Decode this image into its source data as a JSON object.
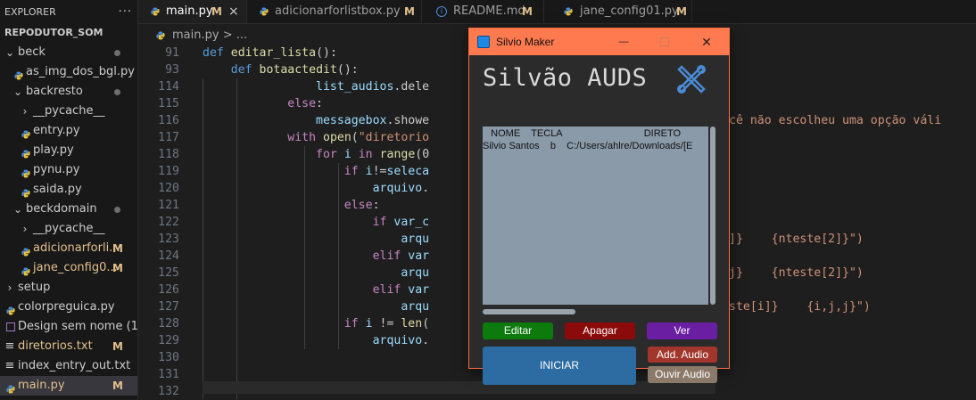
{
  "sidebar": {
    "header": "EXPLORER",
    "more": "···",
    "project": "REPODUTOR_SOM",
    "items": [
      {
        "label": "beck",
        "type": "folder-open"
      },
      {
        "label": "as_img_dos_bgl.py",
        "type": "py"
      },
      {
        "label": "backresto",
        "type": "folder-open"
      },
      {
        "label": "__pycache__",
        "type": "folder-closed"
      },
      {
        "label": "entry.py",
        "type": "py"
      },
      {
        "label": "play.py",
        "type": "py"
      },
      {
        "label": "pynu.py",
        "type": "py"
      },
      {
        "label": "saida.py",
        "type": "py"
      },
      {
        "label": "beckdomain",
        "type": "folder-open"
      },
      {
        "label": "__pycache__",
        "type": "folder-closed"
      },
      {
        "label": "adicionarforli...",
        "type": "py",
        "mark": "M"
      },
      {
        "label": "jane_config0...",
        "type": "py",
        "mark": "M"
      },
      {
        "label": "setup",
        "type": "folder-closed"
      },
      {
        "label": "colorpreguica.py",
        "type": "py"
      },
      {
        "label": "Design sem nome (10...",
        "type": "img"
      },
      {
        "label": "diretorios.txt",
        "type": "txt",
        "mark": "M"
      },
      {
        "label": "index_entry_out.txt",
        "type": "txt"
      },
      {
        "label": "main.py",
        "type": "py",
        "mark": "M"
      }
    ]
  },
  "tabs": [
    {
      "label": "main.py",
      "mark": "M",
      "close": "×"
    },
    {
      "label": "adicionarforlistbox.py",
      "mark": "M"
    },
    {
      "label": "README.md",
      "mark": "M"
    },
    {
      "label": "jane_config01.py",
      "mark": "M"
    }
  ],
  "breadcrumb": "main.py > ...",
  "code_lines": [
    {
      "n": "91",
      "t": "def editar_lista():"
    },
    {
      "n": "93",
      "t": "    def botaactedit():"
    },
    {
      "n": "114",
      "t": "                list_audios.dele"
    },
    {
      "n": "115",
      "t": "            else:"
    },
    {
      "n": "116",
      "t": "                messagebox.showe"
    },
    {
      "n": "117",
      "t": "            with open(\"diretorio"
    },
    {
      "n": "118",
      "t": "                for i in range(0"
    },
    {
      "n": "119",
      "t": "                    if i!=seleca"
    },
    {
      "n": "120",
      "t": "                        arquivo."
    },
    {
      "n": "121",
      "t": "                    else:"
    },
    {
      "n": "122",
      "t": "                        if var_c"
    },
    {
      "n": "123",
      "t": "                            arqu"
    },
    {
      "n": "124",
      "t": "                        elif var"
    },
    {
      "n": "125",
      "t": "                            arqu"
    },
    {
      "n": "126",
      "t": "                        elif var"
    },
    {
      "n": "127",
      "t": "                            arqu"
    },
    {
      "n": "128",
      "t": "                    if i != len("
    },
    {
      "n": "129",
      "t": "                        arquivo."
    },
    {
      "n": "130",
      "t": ""
    },
    {
      "n": "131",
      "t": ""
    },
    {
      "n": "132",
      "t": ""
    }
  ],
  "code_right": {
    "l116": "cê não escolheu uma opção váli",
    "l123": "]}    {nteste[2]}\")",
    "l125": "j}    {nteste[2]}\")",
    "l127": "ste[i]}    {i,j,j}\")"
  },
  "window": {
    "title": "Silvio Maker",
    "minimize": "—",
    "maximize": "☐",
    "close": "✕",
    "app_heading": "Silvão AUDS",
    "list_header": "   NOME    TECLA                              DIRETO",
    "list_row": "Silvio Santos    b    C:/Users/ahlre/Downloads/[E",
    "buttons": {
      "editar": "Editar",
      "apagar": "Apagar",
      "ver": "Ver",
      "iniciar": "INICIAR",
      "add_audio": "Add. Audio",
      "ouvir_audio": "Ouvir Audio"
    },
    "colors": {
      "titlebar": "#ff7a4e",
      "editar": "#0d7a0d",
      "apagar": "#8b0a0a",
      "ver": "#6a1fa3",
      "iniciar": "#2c6ca3",
      "add_audio": "#a2362c",
      "ouvir_audio": "#8b7a6a"
    }
  }
}
